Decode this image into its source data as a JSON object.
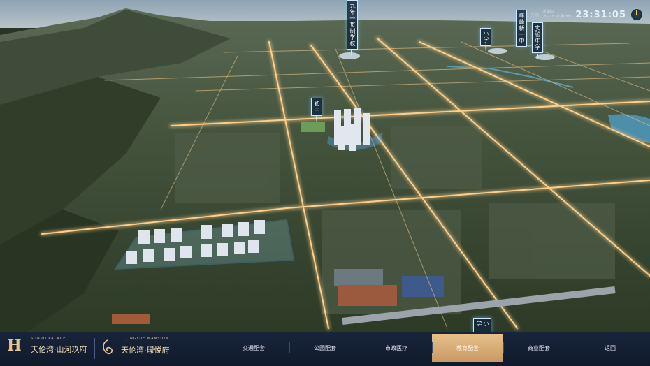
{
  "map": {
    "pins": [
      {
        "name": "pin-nine-year-school",
        "label": "九年一贯制学校"
      },
      {
        "name": "pin-primary-school",
        "label": "小学"
      },
      {
        "name": "pin-fengfeng-new-middle",
        "label": "峰峰新一中"
      },
      {
        "name": "pin-experimental-middle",
        "label": "实验中学"
      },
      {
        "name": "pin-junior-high",
        "label": "初中"
      },
      {
        "name": "pin-bottom-primary",
        "label": "小学"
      }
    ]
  },
  "hud": {
    "weather": "天晴",
    "weekday": "星期四",
    "date": "2021年07月08日",
    "clock": "23:31:05",
    "icon": "compass-icon"
  },
  "brand": {
    "left_en": "SUNVO PALACE",
    "left_cn": "天伦湾·山河玖府",
    "right_en": "JINGYUE MANSION",
    "right_cn": "天伦湾·璟悦府"
  },
  "nav": {
    "items": [
      "交通配套",
      "公园配套",
      "市政医疗",
      "教育配套",
      "商业配套",
      "返回"
    ],
    "active_index": 3
  },
  "colors": {
    "accent": "#d4a86f",
    "bar": "#142035",
    "road_glow": "#ffcf8a"
  }
}
